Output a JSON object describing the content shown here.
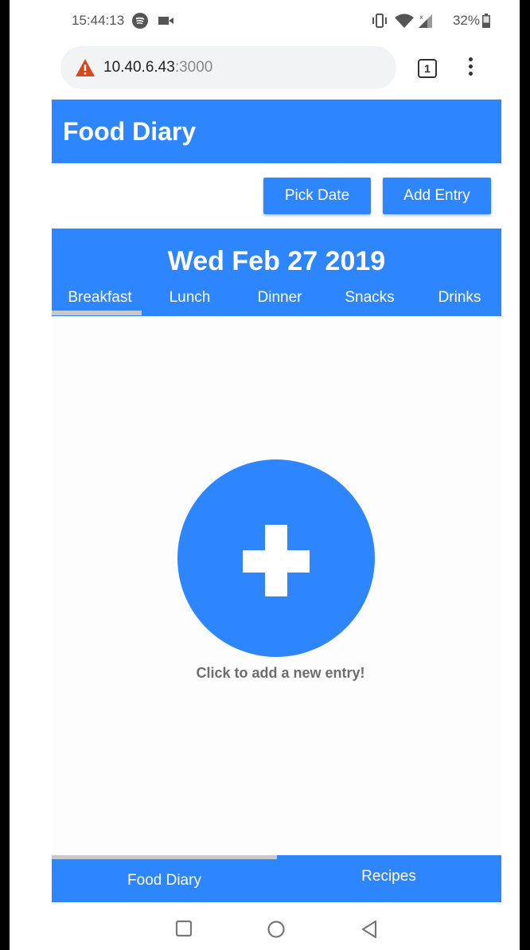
{
  "status_bar": {
    "time": "15:44:13",
    "battery": "32%"
  },
  "browser": {
    "url_host": "10.40.6.43",
    "url_port": ":3000",
    "tab_count": "1"
  },
  "app": {
    "title": "Food Diary",
    "actions": {
      "pick_date_label": "Pick Date",
      "add_entry_label": "Add Entry"
    },
    "date": "Wed Feb 27 2019",
    "tabs": [
      {
        "label": "Breakfast"
      },
      {
        "label": "Lunch"
      },
      {
        "label": "Dinner"
      },
      {
        "label": "Snacks"
      },
      {
        "label": "Drinks"
      }
    ],
    "selected_tab": "Breakfast",
    "add_hint": "Click to add a new entry!",
    "bottom_nav": [
      {
        "label": "Food Diary"
      },
      {
        "label": "Recipes"
      }
    ]
  },
  "colors": {
    "accent": "#2e86ff",
    "indicator": "#c8c8c8",
    "hint_text": "#6d6d6d",
    "warning": "#d9481c"
  }
}
